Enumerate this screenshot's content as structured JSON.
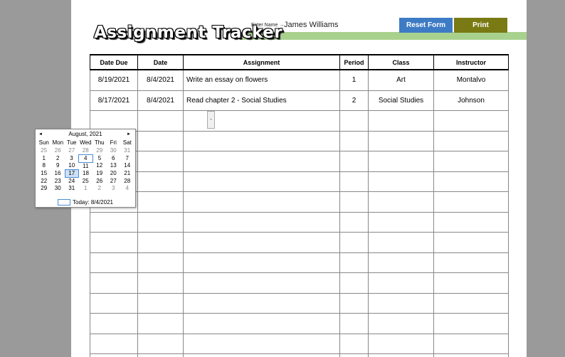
{
  "header": {
    "title": "Assignment Tracker",
    "name_label": "Enter Name →",
    "name_value": "James Williams",
    "reset_label": "Reset Form",
    "print_label": "Print"
  },
  "colors": {
    "reset_button": "#3e7bc5",
    "print_button": "#7a7a14",
    "accent_bar": "#a9d18e"
  },
  "table": {
    "columns": [
      "Date Due",
      "Date",
      "Assignment",
      "Period",
      "Class",
      "Instructor"
    ],
    "rows": [
      [
        "8/19/2021",
        "8/4/2021",
        "Write an essay on flowers",
        "1",
        "Art",
        "Montalvo"
      ],
      [
        "8/17/2021",
        "8/4/2021",
        "Read chapter 2 - Social Studies",
        "2",
        "Social Studies",
        "Johnson"
      ],
      [
        "",
        "",
        "",
        "",
        "",
        ""
      ],
      [
        "",
        "",
        "",
        "",
        "",
        ""
      ],
      [
        "",
        "",
        "",
        "",
        "",
        ""
      ],
      [
        "",
        "",
        "",
        "",
        "",
        ""
      ],
      [
        "",
        "",
        "",
        "",
        "",
        ""
      ],
      [
        "",
        "",
        "",
        "",
        "",
        ""
      ],
      [
        "",
        "",
        "",
        "",
        "",
        ""
      ],
      [
        "",
        "",
        "",
        "",
        "",
        ""
      ],
      [
        "",
        "",
        "",
        "",
        "",
        ""
      ],
      [
        "",
        "",
        "",
        "",
        "",
        ""
      ],
      [
        "",
        "",
        "",
        "",
        "",
        ""
      ],
      [
        "",
        "",
        "",
        "",
        "",
        ""
      ],
      [
        "",
        "",
        "",
        "",
        "",
        ""
      ]
    ]
  },
  "dropdown_glyph": "-",
  "calendar": {
    "month_label": "August, 2021",
    "prev_icon": "◄",
    "next_icon": "►",
    "weekdays": [
      "Sun",
      "Mon",
      "Tue",
      "Wed",
      "Thu",
      "Fri",
      "Sat"
    ],
    "weeks": [
      [
        "25",
        "26",
        "27",
        "28",
        "29",
        "30",
        "31"
      ],
      [
        "1",
        "2",
        "3",
        "4",
        "5",
        "6",
        "7"
      ],
      [
        "8",
        "9",
        "10",
        "11",
        "12",
        "13",
        "14"
      ],
      [
        "15",
        "16",
        "17",
        "18",
        "19",
        "20",
        "21"
      ],
      [
        "22",
        "23",
        "24",
        "25",
        "26",
        "27",
        "28"
      ],
      [
        "29",
        "30",
        "31",
        "1",
        "2",
        "3",
        "4"
      ]
    ],
    "selected_day": "4",
    "highlighted_day": "17",
    "today_label": "Today: 8/4/2021"
  }
}
